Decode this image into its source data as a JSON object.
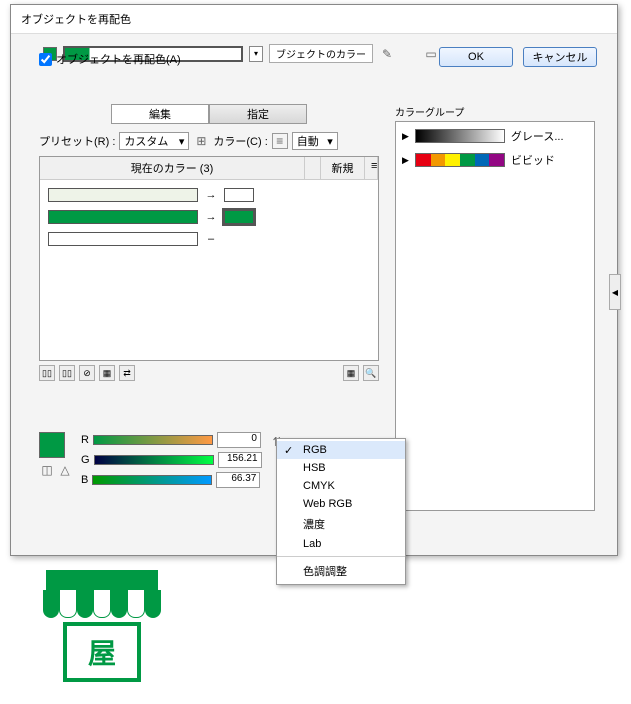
{
  "title": "オブジェクトを再配色",
  "topbar": {
    "label": "ブジェクトのカラー"
  },
  "tabs": {
    "edit": "編集",
    "assign": "指定"
  },
  "preset": {
    "label": "プリセット(R) :",
    "value": "カスタム",
    "colorLabel": "カラー(C) :",
    "autoValue": "自動"
  },
  "colorList": {
    "header_current": "現在のカラー (3)",
    "header_new": "新規"
  },
  "rgb": {
    "rLabel": "R",
    "gLabel": "G",
    "bLabel": "B",
    "r": "0",
    "g": "156.21",
    "b": "66.37"
  },
  "recolorCheckbox": "オブジェクトを再配色(A)",
  "colorGroups": {
    "title": "カラーグループ",
    "items": [
      "グレース...",
      "ビビッド"
    ]
  },
  "buttons": {
    "ok": "OK",
    "cancel": "キャンセル"
  },
  "menu": {
    "items": [
      "RGB",
      "HSB",
      "CMYK",
      "Web RGB",
      "濃度",
      "Lab"
    ],
    "sep": "色調調整",
    "selected": 0
  },
  "vividColors": [
    "#e60012",
    "#f39800",
    "#fff100",
    "#009944",
    "#0068b7",
    "#920783"
  ],
  "logo": "屋"
}
